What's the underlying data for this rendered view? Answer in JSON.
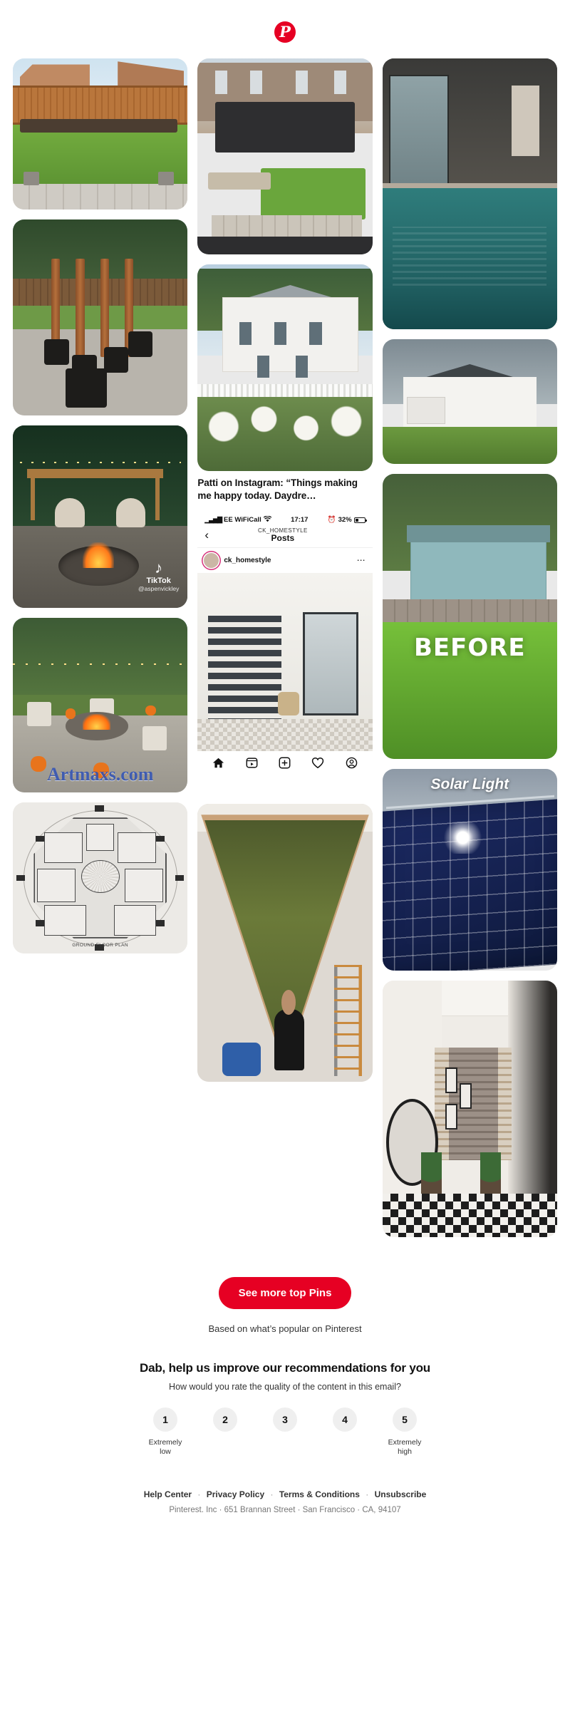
{
  "header": {
    "logo": "pinterest-logo",
    "logo_letter": "P"
  },
  "brand": {
    "red": "#e60023",
    "text": "#111111",
    "muted": "#767676"
  },
  "grid": {
    "col1": [
      {
        "id": "pin-backyard-lawn",
        "alt": "Landscaped backyard with lawn, raised bed and fence"
      },
      {
        "id": "pin-garden-posts",
        "alt": "Backyard with tall wooden posts in black planters"
      },
      {
        "id": "pin-firepit-swings",
        "alt": "Garden pergola with hanging egg chairs and lit fire pit"
      },
      {
        "id": "pin-pumpkin-firepit",
        "alt": "Gravel patio fire pit with pumpkins and string lights",
        "overlay_watermark": "Artmaxs.com"
      },
      {
        "id": "pin-floor-plan",
        "alt": "Octagonal ground floor plan drawing",
        "plan_caption": "GROUND FLOOR PLAN"
      }
    ],
    "col2": [
      {
        "id": "pin-pergola-deck",
        "alt": "Modern garden with black pergola, bench seating and lawn"
      },
      {
        "id": "pin-white-house-hydrangeas",
        "alt": "White house with picket fence and white hydrangeas",
        "caption": "Patti on Instagram: “Things making me happy today. Daydre…"
      },
      {
        "id": "pin-instagram-screenshot",
        "alt": "Instagram post screenshot of a hallway staircase",
        "phone": {
          "status": {
            "carrier": "EE WiFiCall",
            "signal": "signal-bars-icon",
            "wifi": "wifi-icon",
            "time": "17:17",
            "alarm": "alarm-icon",
            "battery": "32%"
          },
          "nav": {
            "back": "back-chevron-icon",
            "account": "CK_HOMESTYLE",
            "title": "Posts"
          },
          "user": {
            "name": "ck_homestyle",
            "avatar": "user-avatar",
            "more": "more-options-icon"
          },
          "tabbar": [
            "home-icon",
            "reels-icon",
            "add-post-icon",
            "heart-icon",
            "profile-icon"
          ]
        }
      },
      {
        "id": "pin-moss-wall",
        "alt": "Man installing a large moss feature wall with a ladder"
      }
    ],
    "col3": [
      {
        "id": "pin-indoor-pool",
        "alt": "Modern indoor swimming pool with glass wall"
      },
      {
        "id": "pin-modern-farmhouse",
        "alt": "White modern farmhouse under stormy sky"
      },
      {
        "id": "pin-before-garden",
        "alt": "Sloped backyard lawn before renovation",
        "overlay_text": "BEFORE"
      },
      {
        "id": "pin-solar-light",
        "alt": "Close up of solar panel with sun glare",
        "overlay_text": "Solar Light"
      },
      {
        "id": "pin-hallway-mirror",
        "alt": "Hallway with round mirror, plants and checkered floor"
      }
    ]
  },
  "cta": {
    "button_label": "See more top Pins",
    "subtitle": "Based on what’s popular on Pinterest"
  },
  "survey": {
    "title": "Dab, help us improve our recommendations for you",
    "question": "How would you rate the quality of the content in this email?",
    "options": [
      {
        "value": "1",
        "label": "Extremely\nlow"
      },
      {
        "value": "2",
        "label": ""
      },
      {
        "value": "3",
        "label": ""
      },
      {
        "value": "4",
        "label": ""
      },
      {
        "value": "5",
        "label": "Extremely\nhigh"
      }
    ]
  },
  "footer": {
    "links": [
      "Help Center",
      "Privacy Policy",
      "Terms & Conditions",
      "Unsubscribe"
    ],
    "separator": "·",
    "address": "Pinterest. Inc  ·  651 Brannan Street  ·  San Francisco  ·  CA, 94107"
  }
}
